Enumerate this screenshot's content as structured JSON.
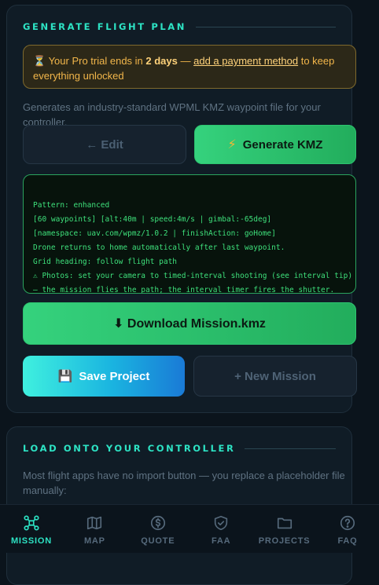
{
  "card1": {
    "title": "GENERATE FLIGHT PLAN",
    "trial": {
      "icon": "hourglass",
      "pre": "Your Pro trial ends in ",
      "bold": "2 days",
      "mid": " — ",
      "link": "add a payment method",
      "post": " to keep everything unlocked"
    },
    "description": "Generates an industry-standard WPML KMZ waypoint file for your controller.",
    "edit_label": "← Edit",
    "generate_label": "Generate KMZ",
    "generate_icon": "lightning",
    "log_lines": [
      "Pattern: enhanced",
      "[60 waypoints] [alt:40m | speed:4m/s | gimbal:-65deg]",
      "[namespace: uav.com/wpmz/1.0.2 | finishAction: goHome]",
      "Drone returns to home automatically after last waypoint.",
      "Grid heading: follow flight path",
      "⚠ Photos: set your camera to timed-interval shooting (see interval tip)",
      "— the mission flies the path; the interval timer fires the shutter."
    ],
    "download_label": "⬇ Download Mission.kmz",
    "save_label": "Save Project",
    "save_icon": "floppy-disk",
    "new_label": "+ New Mission"
  },
  "card2": {
    "title": "LOAD ONTO YOUR CONTROLLER",
    "description": "Most flight apps have no import button — you replace a placeholder file manually:"
  },
  "tabs": [
    {
      "label": "MISSION",
      "icon": "drone-icon",
      "active": true
    },
    {
      "label": "MAP",
      "icon": "map-icon",
      "active": false
    },
    {
      "label": "QUOTE",
      "icon": "dollar-icon",
      "active": false
    },
    {
      "label": "FAA",
      "icon": "shield-check-icon",
      "active": false
    },
    {
      "label": "PROJECTS",
      "icon": "folder-icon",
      "active": false
    },
    {
      "label": "FAQ",
      "icon": "help-icon",
      "active": false
    }
  ],
  "colors": {
    "accent": "#2de3c4",
    "green": "#35d27d",
    "warning": "#f2b64a",
    "background": "#0b141c"
  }
}
